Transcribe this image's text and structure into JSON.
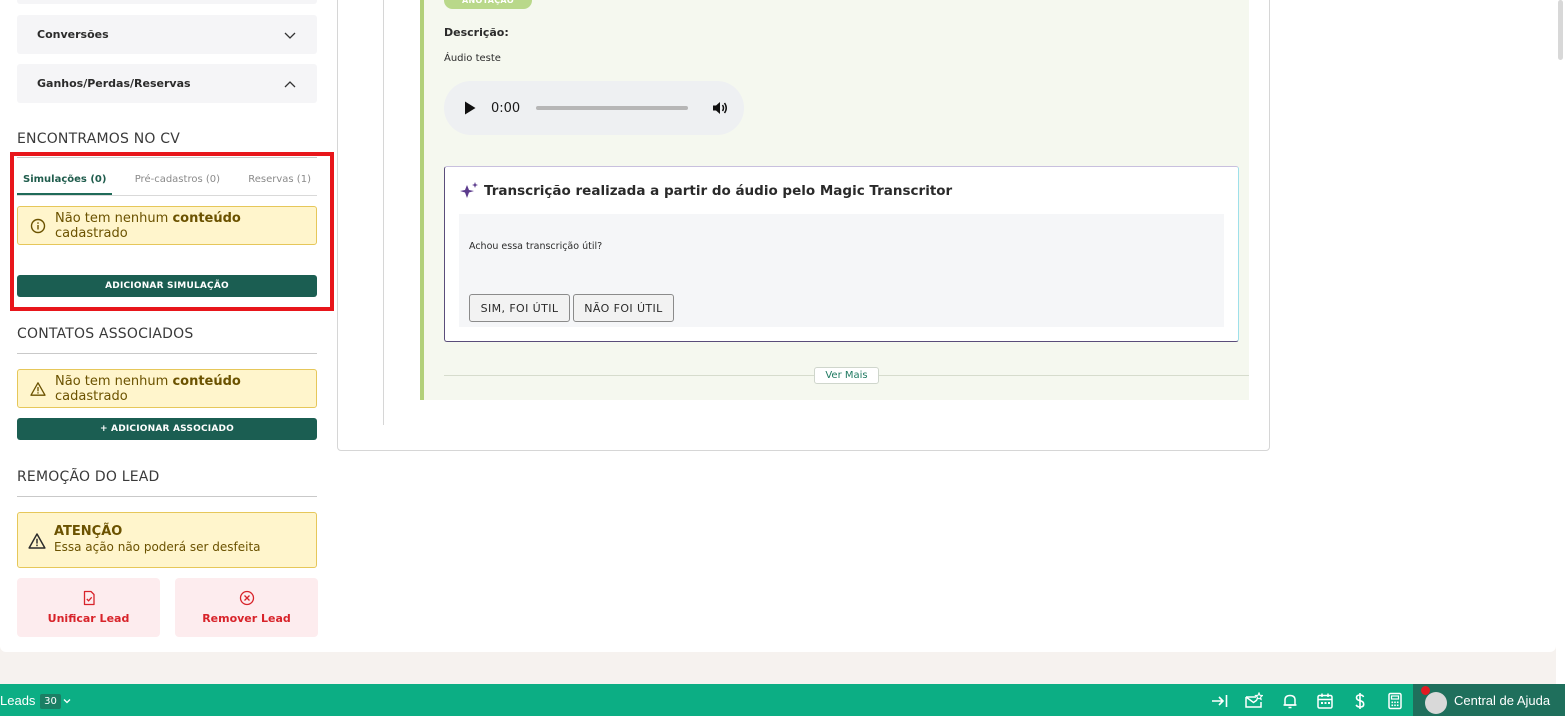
{
  "sidebar": {
    "accordions": [
      {
        "label": "Conversões",
        "expanded": false
      },
      {
        "label": "Ganhos/Perdas/Reservas",
        "expanded": true
      }
    ],
    "cv_section": {
      "title": "ENCONTRAMOS NO CV",
      "tabs": [
        {
          "label": "Simulações (0)",
          "active": true
        },
        {
          "label": "Pré-cadastros (0)",
          "active": false
        },
        {
          "label": "Reservas (1)",
          "active": false
        }
      ],
      "alert": {
        "prefix": "Não tem nenhum",
        "bold": "conteúdo",
        "suffix": "cadastrado"
      },
      "add_button": "ADICIONAR SIMULAÇÃO"
    },
    "contacts_section": {
      "title": "CONTATOS ASSOCIADOS",
      "alert": {
        "prefix": "Não tem nenhum",
        "bold": "conteúdo",
        "suffix": "cadastrado"
      },
      "add_button": "+ ADICIONAR ASSOCIADO"
    },
    "removal_section": {
      "title": "REMOÇÃO DO LEAD",
      "attention_title": "ATENÇÃO",
      "attention_text": "Essa ação não poderá ser desfeita",
      "unify_button": "Unificar Lead",
      "remove_button": "Remover Lead"
    }
  },
  "note": {
    "badge": "ANOTAÇÃO",
    "description_label": "Descrição:",
    "description_text": "Áudio teste",
    "audio": {
      "current_time": "0:00"
    },
    "transcription": {
      "title": "Transcrição realizada a partir do áudio pelo Magic Transcritor",
      "question": "Achou essa transcrição útil?",
      "yes_button": "SIM, FOI ÚTIL",
      "no_button": "NÃO FOI ÚTIL"
    },
    "see_more": "Ver Mais"
  },
  "bottom_bar": {
    "leads_label": "Leads",
    "leads_count": "30",
    "icons": [
      "collapse-right-icon",
      "mail-star-icon",
      "bell-icon",
      "calendar-icon",
      "dollar-icon",
      "calculator-icon"
    ],
    "help_label": "Central de Ajuda"
  },
  "colors": {
    "brand_dark_green": "#1b5e52",
    "bottom_bar_green": "#0cae84",
    "highlight_red": "#e8161b",
    "alert_yellow": "#fff5cc",
    "danger_red": "#d8232a"
  }
}
